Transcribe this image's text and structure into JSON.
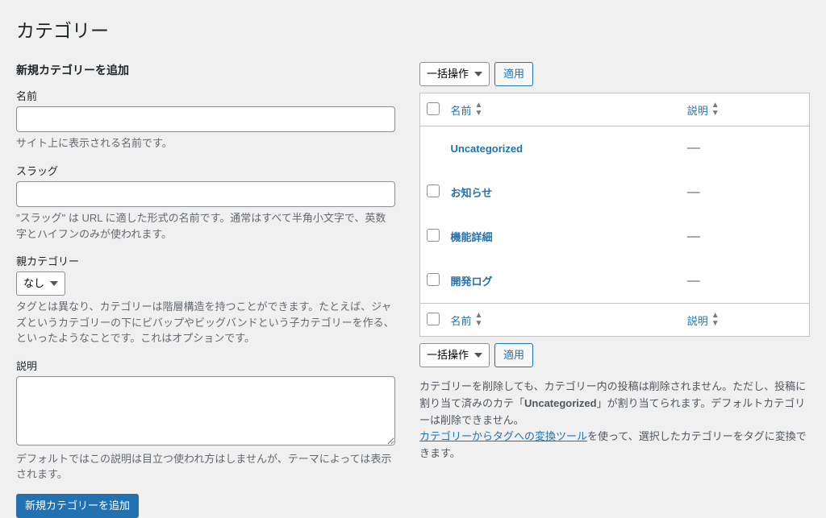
{
  "page_title": "カテゴリー",
  "form": {
    "heading": "新規カテゴリーを追加",
    "name": {
      "label": "名前",
      "value": "",
      "desc": "サイト上に表示される名前です。"
    },
    "slug": {
      "label": "スラッグ",
      "value": "",
      "desc": "\"スラッグ\" は URL に適した形式の名前です。通常はすべて半角小文字で、英数字とハイフンのみが使われます。"
    },
    "parent": {
      "label": "親カテゴリー",
      "selected": "なし",
      "desc": "タグとは異なり、カテゴリーは階層構造を持つことができます。たとえば、ジャズというカテゴリーの下にビバップやビッグバンドという子カテゴリーを作る、といったようなことです。これはオプションです。"
    },
    "description": {
      "label": "説明",
      "value": "",
      "desc": "デフォルトではこの説明は目立つ使われ方はしませんが、テーマによっては表示されます。"
    },
    "submit": "新規カテゴリーを追加"
  },
  "tablenav": {
    "bulk_label": "一括操作",
    "apply": "適用"
  },
  "columns": {
    "name": "名前",
    "desc": "説明"
  },
  "rows": [
    {
      "name": "Uncategorized",
      "desc": "—",
      "checkbox": false
    },
    {
      "name": "お知らせ",
      "desc": "—",
      "checkbox": true
    },
    {
      "name": "機能詳細",
      "desc": "—",
      "checkbox": true
    },
    {
      "name": "開発ログ",
      "desc": "—",
      "checkbox": true
    }
  ],
  "notes": {
    "line1_a": "カテゴリーを削除しても、カテゴリー内の投稿は削除されません。ただし、投稿に割り当て済みのカテ「",
    "line1_b": "Uncategorized",
    "line1_c": "」が割り当てられます。デフォルトカテゴリーは削除できません。",
    "link": "カテゴリーからタグへの変換ツール",
    "line2_tail": "を使って、選択したカテゴリーをタグに変換できます。"
  }
}
